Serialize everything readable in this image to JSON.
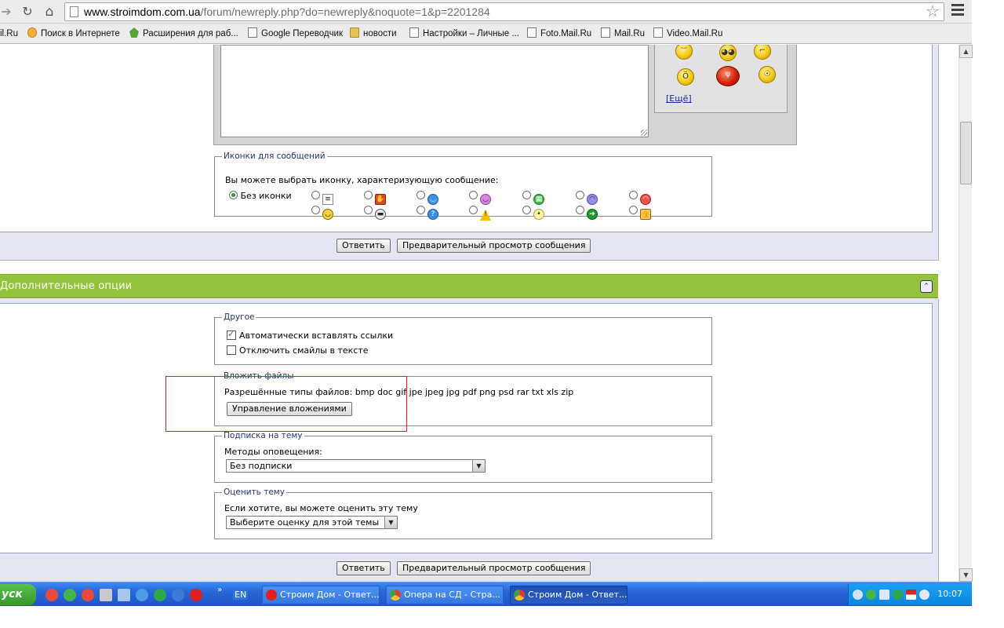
{
  "browser": {
    "url_host": "www.stroimdom.com.ua",
    "url_path": "/forum/newreply.php?do=newreply&noquote=1&p=2201284",
    "bookmarks": [
      {
        "label": "il.Ru",
        "icon": "page-icon"
      },
      {
        "label": "Поиск в Интернете",
        "icon": "search-icon"
      },
      {
        "label": "Расширения для раб...",
        "icon": "puzzle-icon"
      },
      {
        "label": "Google Переводчик",
        "icon": "page-icon"
      },
      {
        "label": "новости",
        "icon": "folder-icon"
      },
      {
        "label": "Настройки – Личные ...",
        "icon": "page-icon"
      },
      {
        "label": "Foto.Mail.Ru",
        "icon": "page-icon"
      },
      {
        "label": "Mail.Ru",
        "icon": "page-icon"
      },
      {
        "label": "Video.Mail.Ru",
        "icon": "page-icon"
      }
    ]
  },
  "editor": {
    "more_smilies": "[Ещё]"
  },
  "post_icons": {
    "legend": "Иконки для сообщений",
    "hint": "Вы можете выбрать иконку, характеризующую сообщение:",
    "no_icon_label": "Без иконки",
    "icons": [
      "document",
      "thumbs-down",
      "smile-blue",
      "smile-purple",
      "grin-green",
      "sad-purple",
      "angry-red",
      "smile-yellow",
      "cool",
      "question",
      "warning",
      "lightbulb",
      "arrow-right",
      "thumbs-up"
    ]
  },
  "actions": {
    "submit_label": "Ответить",
    "preview_label": "Предварительный просмотр сообщения"
  },
  "additional_options": {
    "title": "Дополнительные опции",
    "other": {
      "legend": "Другое",
      "auto_links_label": "Автоматически вставлять ссылки",
      "auto_links_checked": true,
      "disable_smilies_label": "Отключить смайлы в тексте",
      "disable_smilies_checked": false
    },
    "attachments": {
      "legend": "Вложить файлы",
      "allowed_types": "Разрешённые типы файлов: bmp doc gif jpe jpeg jpg pdf png psd rar txt xls zip",
      "manage_button": "Управление вложениями"
    },
    "subscription": {
      "legend": "Подписка на тему",
      "methods_label": "Методы оповещения:",
      "selected": "Без подписки"
    },
    "rating": {
      "legend": "Оценить тему",
      "hint": "Если хотите, вы можете оценить эту тему",
      "selected": "Выберите оценку для этой темы"
    }
  },
  "taskbar": {
    "start_label": "уск",
    "language": "EN",
    "tasks": [
      {
        "label": "Строим Дом - Ответ...",
        "icon": "opera-icon",
        "active": false
      },
      {
        "label": "Опера на СД - Стра...",
        "icon": "chrome-icon",
        "active": false
      },
      {
        "label": "Строим Дом - Ответ...",
        "icon": "chrome-icon",
        "active": true
      }
    ],
    "clock": "10:07"
  },
  "colors": {
    "section_header": "#93c33a",
    "panel_bg": "#e4e6f3",
    "taskbar": "#2766d8",
    "highlight": "#e02020"
  }
}
